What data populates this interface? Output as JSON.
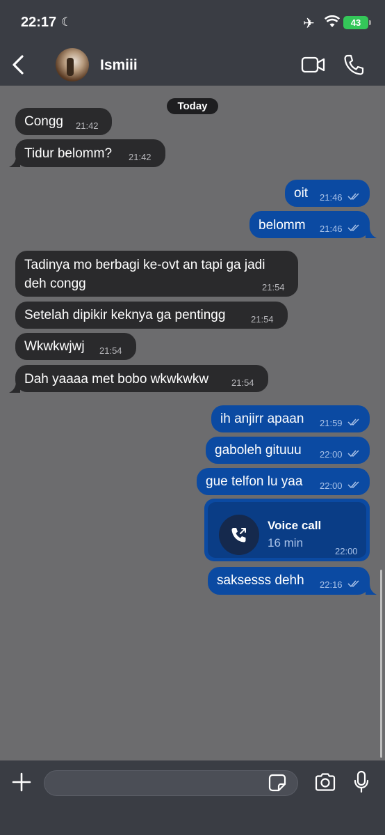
{
  "status_bar": {
    "time": "22:17",
    "battery": "43"
  },
  "header": {
    "contact_name": "Ismiii"
  },
  "date_separator": "Today",
  "messages": [
    {
      "dir": "in",
      "text": "Congg",
      "time": "21:42"
    },
    {
      "dir": "in",
      "text": "Tidur belomm?",
      "time": "21:42"
    },
    {
      "dir": "out",
      "text": "oit",
      "time": "21:46"
    },
    {
      "dir": "out",
      "text": "belomm",
      "time": "21:46"
    },
    {
      "dir": "in",
      "text_line1": "Tadinya mo berbagi ke-ovt an tapi ga jadi",
      "text_line2": "deh congg",
      "time": "21:54"
    },
    {
      "dir": "in",
      "text": "Setelah dipikir keknya ga pentingg",
      "time": "21:54"
    },
    {
      "dir": "in",
      "text": "Wkwkwjwj",
      "time": "21:54"
    },
    {
      "dir": "in",
      "text": "Dah yaaaa met bobo wkwkwkw",
      "time": "21:54"
    },
    {
      "dir": "out",
      "text": "ih anjirr apaan",
      "time": "21:59"
    },
    {
      "dir": "out",
      "text": "gaboleh gituuu",
      "time": "22:00"
    },
    {
      "dir": "out",
      "text": "gue telfon lu yaa",
      "time": "22:00"
    },
    {
      "dir": "out",
      "text": "saksesss dehh",
      "time": "22:16"
    }
  ],
  "voice_call": {
    "title": "Voice call",
    "duration": "16 min",
    "time": "22:00"
  },
  "composer": {
    "placeholder": ""
  }
}
